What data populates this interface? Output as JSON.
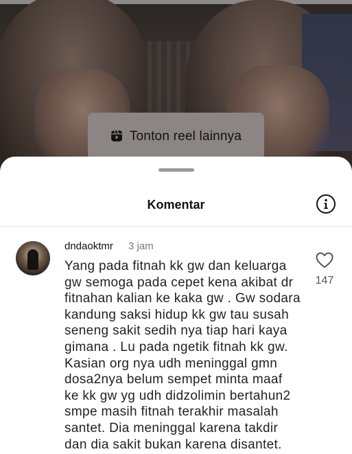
{
  "reel_prompt": {
    "label": "Tonton reel lainnya",
    "icon": "reels-icon"
  },
  "sheet": {
    "title": "Komentar",
    "info_icon": "info-icon"
  },
  "comment": {
    "username": "dndaoktmr",
    "time": "3 jam",
    "likes": "147",
    "like_icon": "heart-outline-icon",
    "lines": [
      "Yang pada fitnah kk gw dan keluarga",
      "gw semoga pada cepet kena akibat dr",
      "fitnahan kalian ke kaka gw . Gw sodara",
      "kandung saksi hidup kk gw tau susah",
      "seneng sakit sedih nya tiap hari kaya",
      "gimana . Lu pada ngetik fitnah kk gw.",
      "Kasian org nya udh meninggal gmn",
      "dosa2nya belum sempet minta maaf",
      "ke kk gw yg udh didzolimin bertahun2",
      "smpe masih fitnah terakhir masalah",
      "santet. Dia meninggal karena takdir",
      "dan dia sakit bukan karena disantet."
    ]
  },
  "colors": {
    "sheet_bg": "#ffffff",
    "pill_bg": "#8b8685",
    "text": "#111111",
    "muted": "#777777"
  }
}
